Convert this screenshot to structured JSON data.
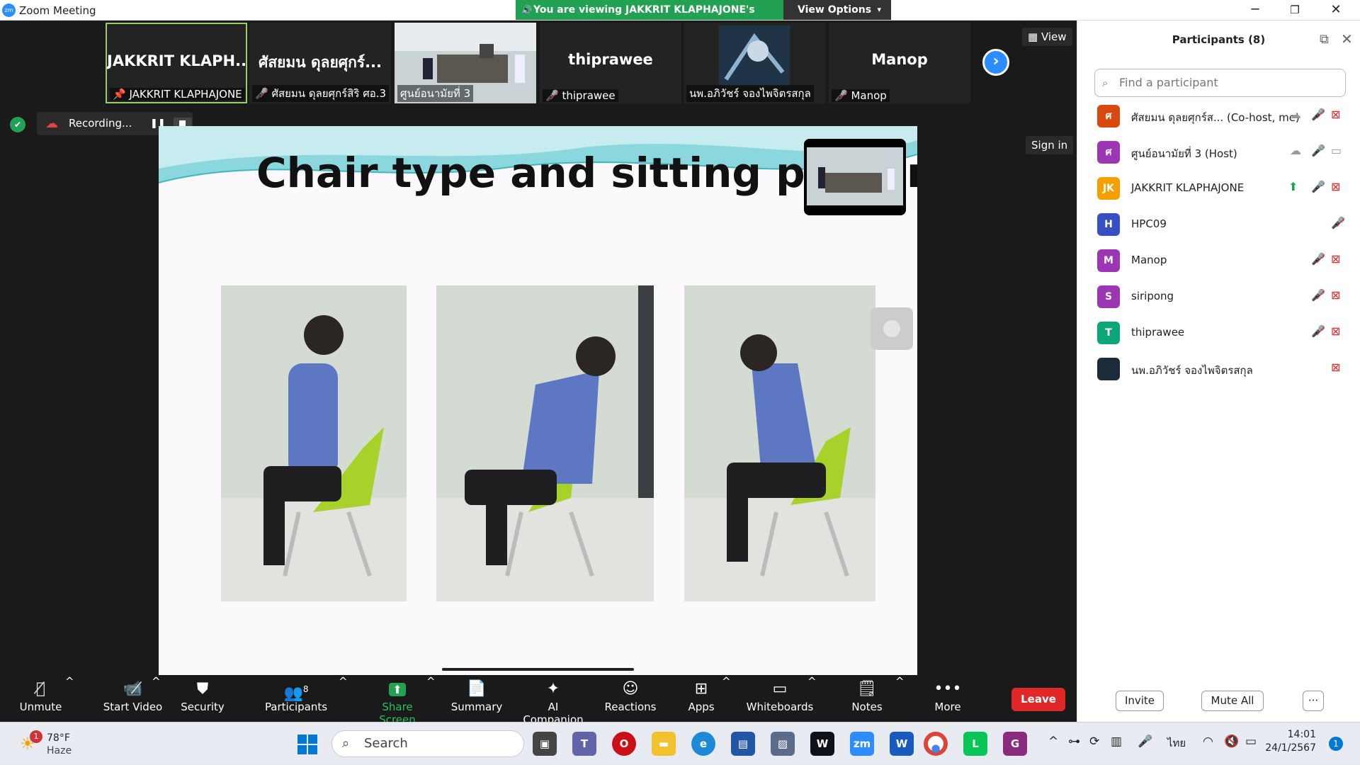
{
  "window": {
    "title": "Zoom Meeting"
  },
  "banner": {
    "viewing": "You are viewing JAKKRIT KLAPHAJONE's screen",
    "view_options": "View Options"
  },
  "thumbnails": [
    {
      "big": "JAKKRIT  KLAPH...",
      "label": "JAKKRIT KLAPHAJONE"
    },
    {
      "big": "ศัสยมน ดุลยศุกร์...",
      "label": "ศัสยมน ดุลยศุกร์สิริ ศอ.3"
    },
    {
      "big": "",
      "label": "ศูนย์อนามัยที่ 3"
    },
    {
      "big": "thiprawee",
      "label": "thiprawee"
    },
    {
      "big": "",
      "label": "นพ.อภิวัชร์ จองไพจิตรสกุล"
    },
    {
      "big": "Manop",
      "label": "Manop"
    }
  ],
  "view_button": "View",
  "recording": {
    "label": "Recording..."
  },
  "sign_in": "Sign in",
  "slide": {
    "title": "Chair type and sitting postur"
  },
  "toolbar": {
    "unmute": "Unmute",
    "start_video": "Start Video",
    "security": "Security",
    "participants": "Participants",
    "participants_count": "8",
    "share_screen": "Share Screen",
    "summary": "Summary",
    "ai_companion": "AI Companion",
    "reactions": "Reactions",
    "apps": "Apps",
    "whiteboards": "Whiteboards",
    "notes": "Notes",
    "more": "More",
    "leave": "Leave"
  },
  "panel": {
    "title": "Participants (8)",
    "search_placeholder": "Find a participant",
    "participants": [
      {
        "initial": "ศ",
        "name": "ศัสยมน ดุลยศุกร์ส... (Co-host, me)",
        "color": "#d9480f"
      },
      {
        "initial": "ศ",
        "name": "ศูนย์อนามัยที่ 3 (Host)",
        "color": "#9c36b5"
      },
      {
        "initial": "JK",
        "name": "JAKKRIT KLAPHAJONE",
        "color": "#f59f00"
      },
      {
        "initial": "H",
        "name": "HPC09",
        "color": "#364fc7"
      },
      {
        "initial": "M",
        "name": "Manop",
        "color": "#9c36b5"
      },
      {
        "initial": "S",
        "name": "siripong",
        "color": "#9c36b5"
      },
      {
        "initial": "T",
        "name": "thiprawee",
        "color": "#0ca678"
      },
      {
        "initial": "",
        "name": "นพ.อภิวัชร์ จองไพจิตรสกุล",
        "color": "#1c2b3a"
      }
    ],
    "invite": "Invite",
    "mute_all": "Mute All",
    "more": "···"
  },
  "taskbar": {
    "weather_badge": "1",
    "temperature": "78°F",
    "condition": "Haze",
    "search": "Search",
    "language": "ไทย",
    "time": "14:01",
    "date": "24/1/2567",
    "notifications": "1"
  }
}
